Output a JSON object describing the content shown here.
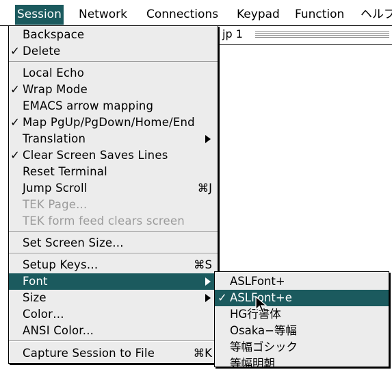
{
  "menubar": {
    "items": [
      "Session",
      "Network",
      "Connections",
      "Keypad",
      "Function",
      "ヘルプ"
    ]
  },
  "window": {
    "title": "jp 1"
  },
  "session_menu": {
    "items": [
      {
        "label": "Backspace",
        "checked": false,
        "shortcut": "",
        "submenu": false,
        "disabled": false
      },
      {
        "label": "Delete",
        "checked": true,
        "shortcut": "",
        "submenu": false,
        "disabled": false
      },
      {
        "label": "Local Echo",
        "checked": false,
        "shortcut": "",
        "submenu": false,
        "disabled": false
      },
      {
        "label": "Wrap Mode",
        "checked": true,
        "shortcut": "",
        "submenu": false,
        "disabled": false
      },
      {
        "label": "EMACS arrow mapping",
        "checked": false,
        "shortcut": "",
        "submenu": false,
        "disabled": false
      },
      {
        "label": "Map PgUp/PgDown/Home/End",
        "checked": true,
        "shortcut": "",
        "submenu": false,
        "disabled": false
      },
      {
        "label": "Translation",
        "checked": false,
        "shortcut": "",
        "submenu": true,
        "disabled": false
      },
      {
        "label": "Clear Screen Saves Lines",
        "checked": true,
        "shortcut": "",
        "submenu": false,
        "disabled": false
      },
      {
        "label": "Reset Terminal",
        "checked": false,
        "shortcut": "",
        "submenu": false,
        "disabled": false
      },
      {
        "label": "Jump Scroll",
        "checked": false,
        "shortcut": "⌘J",
        "submenu": false,
        "disabled": false
      },
      {
        "label": "TEK Page...",
        "checked": false,
        "shortcut": "",
        "submenu": false,
        "disabled": true
      },
      {
        "label": "TEK form feed clears screen",
        "checked": false,
        "shortcut": "",
        "submenu": false,
        "disabled": true
      },
      {
        "label": "Set Screen Size…",
        "checked": false,
        "shortcut": "",
        "submenu": false,
        "disabled": false
      },
      {
        "label": "Setup Keys…",
        "checked": false,
        "shortcut": "⌘S",
        "submenu": false,
        "disabled": false
      },
      {
        "label": "Font",
        "checked": false,
        "shortcut": "",
        "submenu": true,
        "disabled": false,
        "highlighted": true
      },
      {
        "label": "Size",
        "checked": false,
        "shortcut": "",
        "submenu": true,
        "disabled": false
      },
      {
        "label": "Color…",
        "checked": false,
        "shortcut": "",
        "submenu": false,
        "disabled": false
      },
      {
        "label": "ANSI Color...",
        "checked": false,
        "shortcut": "",
        "submenu": false,
        "disabled": false
      },
      {
        "label": "Capture Session to File",
        "checked": false,
        "shortcut": "⌘K",
        "submenu": false,
        "disabled": false
      }
    ]
  },
  "font_submenu": {
    "items": [
      {
        "label": "ASLFont+",
        "checked": false
      },
      {
        "label": "ASLFont+e",
        "checked": true,
        "highlighted": true
      },
      {
        "label": "HG行書体",
        "checked": false
      },
      {
        "label": "Osaka−等幅",
        "checked": false
      },
      {
        "label": "等幅ゴシック",
        "checked": false
      },
      {
        "label": "等幅明朝",
        "checked": false
      }
    ]
  },
  "marks": {
    "check": "✓"
  },
  "colors": {
    "highlight": "#1b5a5e",
    "menu_bg": "#ececec"
  }
}
